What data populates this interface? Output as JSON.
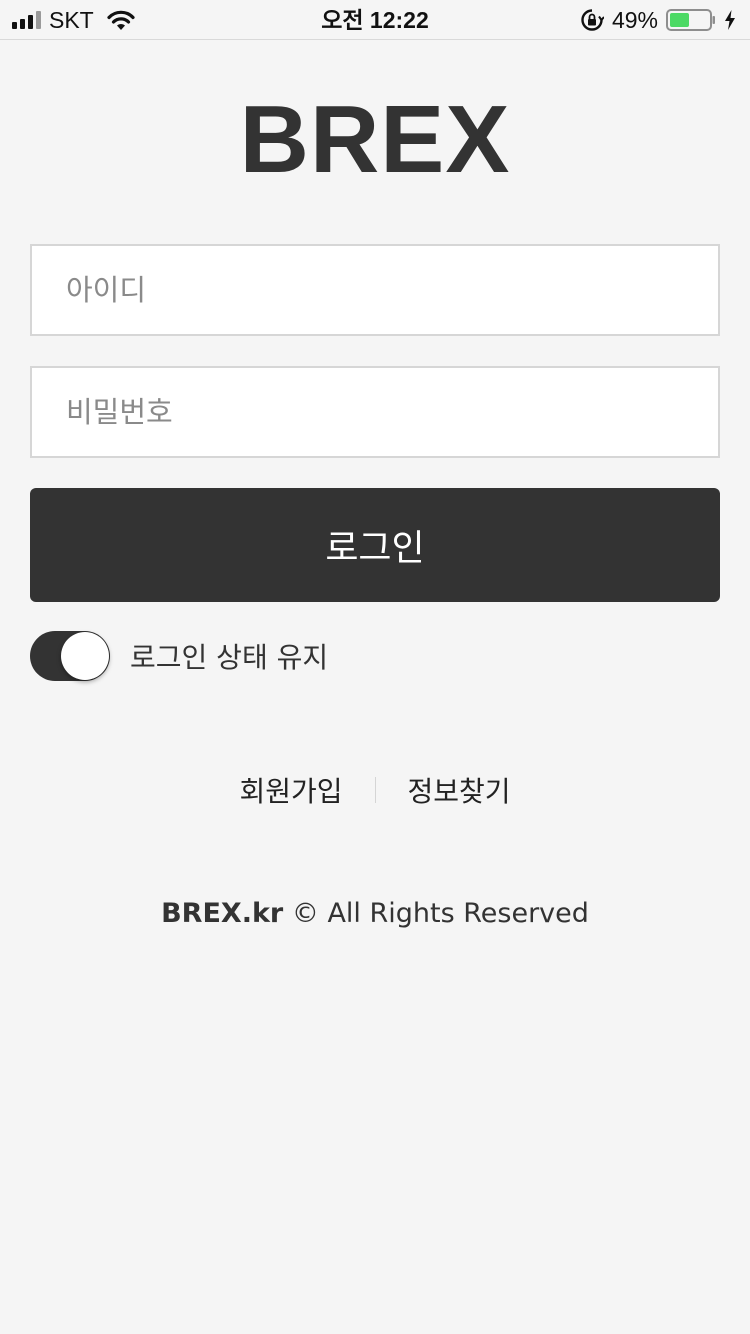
{
  "status_bar": {
    "carrier": "SKT",
    "time": "오전 12:22",
    "battery_percent": "49%",
    "battery_level": 0.49
  },
  "logo": "BREX",
  "form": {
    "id_placeholder": "아이디",
    "id_value": "",
    "password_placeholder": "비밀번호",
    "password_value": "",
    "login_label": "로그인",
    "keep_login_label": "로그인 상태 유지",
    "keep_login_on": true
  },
  "links": {
    "signup_label": "회원가입",
    "find_info_label": "정보찾기"
  },
  "footer": {
    "brand": "BREX.kr",
    "copyright_symbol": "©",
    "rights": "All Rights Reserved"
  },
  "colors": {
    "background": "#f5f5f5",
    "primary": "#333333",
    "battery_fill": "#4cd964"
  }
}
